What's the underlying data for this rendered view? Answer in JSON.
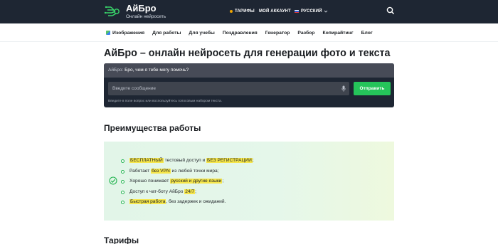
{
  "header": {
    "brand_name": "АйБро",
    "brand_subtitle": "Онлайн нейросеть",
    "nav": [
      {
        "label": "ТАРИФЫ"
      },
      {
        "label": "МОЙ АККАУНТ"
      },
      {
        "label": "РУССКИЙ"
      }
    ],
    "logo_icon": "brain-circuit-icon",
    "search_icon": "search-icon"
  },
  "subnav": [
    {
      "label": "Изображения"
    },
    {
      "label": "Для работы"
    },
    {
      "label": "Для учебы"
    },
    {
      "label": "Поздравления"
    },
    {
      "label": "Генератор"
    },
    {
      "label": "Разбор"
    },
    {
      "label": "Копирайтинг"
    },
    {
      "label": "Блог"
    }
  ],
  "page_title": "АйБро – онлайн нейросеть для генерации фото и текста",
  "chat": {
    "sender": "АйБро:",
    "greeting": "Бро, чем я тебе могу помочь?",
    "input_placeholder": "Введите сообщение",
    "send_label": "Отправить",
    "hint": "Введите в поле вопрос или воспользуйтесь голосовым набором текста."
  },
  "advantages": {
    "title": "Преимущества работы",
    "items": [
      {
        "highlight1": "БЕСПЛАТНЫЙ",
        "text1": " тестовый доступ и ",
        "highlight2": "БЕЗ РЕГИСТРАЦИИ",
        "text2": ";"
      },
      {
        "text1": "Работает ",
        "highlight1": "без VPN",
        "text2": " из любой точки мира;"
      },
      {
        "text1": "Хорошо понимает ",
        "highlight1": "русский и другие языки",
        "text2": ";"
      },
      {
        "text1": "Доступ к чат-боту АйБро ",
        "highlight1": "24/7",
        "text2": ";"
      },
      {
        "highlight1": "Быстрая работа",
        "text1": ", без задержек и ожиданий."
      }
    ]
  },
  "tariffs_title": "Тарифы",
  "colors": {
    "header_bg": "#1e2633",
    "accent_green": "#25c45a",
    "highlight_yellow": "#f6e64a"
  }
}
